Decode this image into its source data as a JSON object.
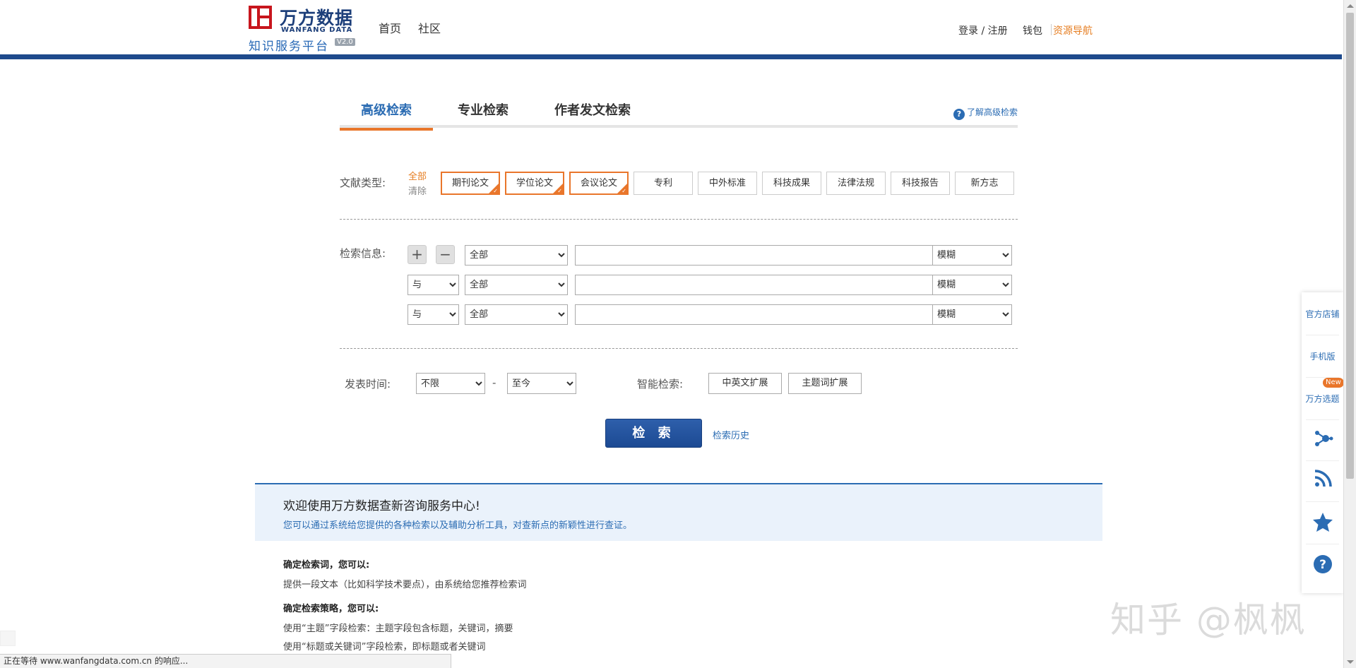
{
  "header": {
    "logo_cn": "万方数据",
    "logo_en": "WANFANG DATA",
    "logo_sub": "知识服务平台",
    "logo_version": "V2.0",
    "nav": [
      "首页",
      "社区"
    ],
    "login": "登录 / 注册",
    "wallet": "钱包",
    "resource_nav": "资源导航"
  },
  "tabs": [
    {
      "label": "高级检索",
      "active": true
    },
    {
      "label": "专业检索",
      "active": false
    },
    {
      "label": "作者发文检索",
      "active": false
    }
  ],
  "help_link": "了解高级检索",
  "doc_type": {
    "label": "文献类型:",
    "all": "全部",
    "clear": "清除",
    "types": [
      {
        "label": "期刊论文",
        "selected": true
      },
      {
        "label": "学位论文",
        "selected": true
      },
      {
        "label": "会议论文",
        "selected": true
      },
      {
        "label": "专利",
        "selected": false
      },
      {
        "label": "中外标准",
        "selected": false
      },
      {
        "label": "科技成果",
        "selected": false
      },
      {
        "label": "法律法规",
        "selected": false
      },
      {
        "label": "科技报告",
        "selected": false
      },
      {
        "label": "新方志",
        "selected": false
      }
    ]
  },
  "search_info": {
    "label": "检索信息:",
    "add": "+",
    "remove": "−",
    "rows": [
      {
        "logic": "",
        "field": "全部",
        "value": "",
        "match": "模糊"
      },
      {
        "logic": "与",
        "field": "全部",
        "value": "",
        "match": "模糊"
      },
      {
        "logic": "与",
        "field": "全部",
        "value": "",
        "match": "模糊"
      }
    ]
  },
  "publish_time": {
    "label": "发表时间:",
    "from": "不限",
    "dash": "-",
    "to": "至今"
  },
  "smart_search": {
    "label": "智能检索:",
    "cn_en": "中英文扩展",
    "topic": "主题词扩展"
  },
  "search_button": "检 索",
  "history_link": "检索历史",
  "info": {
    "title": "欢迎使用万方数据查新咨询服务中心!",
    "desc": "您可以通过系统给您提供的各种检索以及辅助分析工具，对查新点的新颖性进行查证。",
    "section1_head": "确定检索词，您可以:",
    "section1_line1": "提供一段文本（比如科学技术要点），由系统给您推荐检索词",
    "section2_head": "确定检索策略，您可以:",
    "section2_line1": "使用“主题”字段检索：主题字段包含标题，关键词，摘要",
    "section2_line2": "使用“标题或关键词”字段检索，即标题或者关键词"
  },
  "sidebar": {
    "store": "官方店铺",
    "mobile": "手机版",
    "new_badge": "New",
    "topic_select": "万方选题"
  },
  "status_text": "正在等待 www.wanfangdata.com.cn 的响应...",
  "watermark": "知乎 @枫枫"
}
